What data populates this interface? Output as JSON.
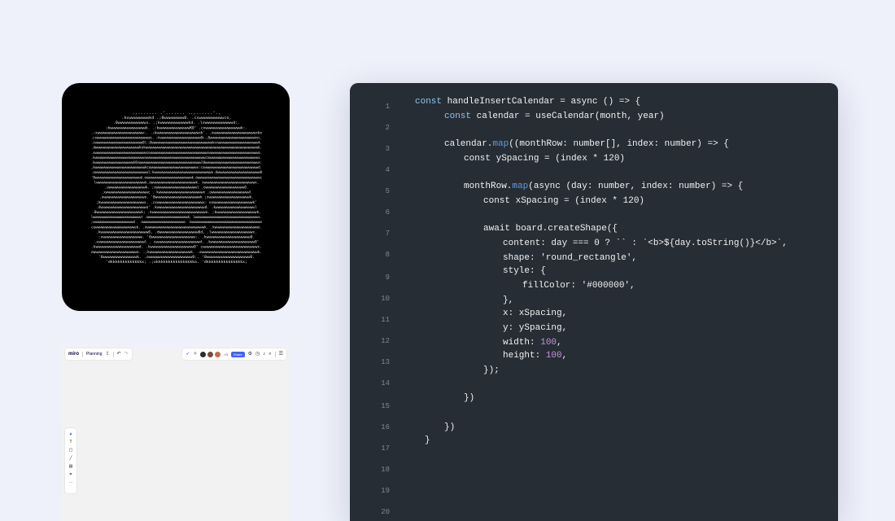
{
  "colors": {
    "page_bg": "#eef0fa",
    "editor_bg": "#262d34",
    "keyword": "#8dc6ef",
    "method": "#5e9fe0",
    "number": "#c792d8",
    "text": "#f1f2f4",
    "line_number": "#7e8794",
    "miro_accent": "#4262ff"
  },
  "ascii_card": {
    "lines": [
      " .,.......      .'.......     ..,......'.,",
      ".kxwwwwwwwwkd     .;0wwwwwwww0.     .cxwwwwwwwwwwco,",
      ".0wwwwwwwwwwwwx.    .;kwwwwwwwwwwwwkd.    .lxwwwwwwwwwwwwd:.",
      ";kwwwwwwwwwwwwwwwwk.   .:kwwwwwwwwwwwwwwK0'  .cxwwwwwwwwwwwwwwwwk:.",
      ".:xwwwwwwwwwwwwwwwwwwwwww:. .;kwwwwwwwwwwwwwwwwwwwwxk'. .xwwwwwwwwwwwwwwwwwwwwxko",
      ".cxwwwwwwwwwwwwwwwwwwwwwwwwwwwwoc.  ;kwwwwwwwwwwwwwwwwwwwwww0c.;0wwwwwwwwwwwwwwwwwwwwwwwwnoc.",
      ".cwwwwwwwwwwwwwwwwwwwwwwwwww0l:;0wwwwwwwwwwwwwwwwwwwwwwwwwwwwwwwwwkxxwwwwwwwwwwwwwwwwwwwwwwk.",
      ".dwwwwwwwwwwwwwwwwwwwwwwkokwwwwwwwwwwwwwwwwwwwwwwwwwwwwwwwwwwwwwwwwwwwwwwwwwwwwwwwwk.",
      ".xwwwwwwwwwwwwwwwwwwwwwwwwwwwwxxwwwwwwwwwwwwwwwwwwwwwwwwwwwwwwwxwwwwwwwwwwwwwwwwwwwwwwwwwwwo.",
      ".kwwwwwwwwwwwwwwwwwwwwwwwwwwwwxwwwwwwwwwwwwwwwwwwwwwwwwwwwwwwwwwwcowwwwwwwwwwwwwwwwwwwwwwwwwwwwc.",
      ".kwwwwwwwwwwwwwwwwwwwwwk0xwwwwwwwwwwwwwwwwwwwwwwwwwwwwwwwwwwl0wwwwwwwwwwwwwwwwwwwwwwwwwwwwwx:",
      ",kwwwwwwwwwwwwwwwwwwwwwwwwwwkcowwwwwwwwwwwwwwwwwwwwwwwwx:cxwwwwwwwwwwwwwwwwwwwwwwwwwwwwd.",
      ".owwwwwwwwwwwwwwwwwwwwwwwwwwl:kwwwwwwwwwwwwwwwwwwwwwwwwwwwwo.dwwwwwwwwwwwwwwwwwwwww0",
      "'0wwwwwwwwwwwwwwwwwwwwwwwwd.owwwwwwwwwwwwwwwwwwwwwwwwk.owwwwwwwwwwwwwwwwwwwwwwwwwwwwwwwwwc",
      "lwwwwwwwwwwwwwwwwwwwwwwwk.owwwwwwwwwwwwwwwwwwwwwk. xwwwwwwwwwwwwwwwwwwwwwwwwx.",
      ".owwwwwwwwwwwwwwwwwk. ;xwwwwwwwwwwwwwwwwwwwl  .owwwwwwwwwwwwwwwwww0.",
      ".xwwwwwwwwwwwwwwwwwwwwc . kwwwwwwwwwwwwwwwwwwwwwx .owwwwwwwwwwwwwwwwwwl",
      ".owwwwwwwwwwwwwwwwwwwo. '0wwwwwwwwwwwwwwwwwwwwwk  ;xwwwwwwwwwwwwwwwwwwwk.",
      ";kwwwwwwwwwwwwwwwwwwwwx. .cxwwwwwwwwwwwwwwwwwwwwwx:   oxwwwwwwwwwwwwwwwwwwk'",
      ".dwwwwwwwwwwwwwwwwwwwwwo'  .kwwwwwwwwwwwwwwwwwwwwwwd.  .kwwwwwwwwwwwwwwwwwwl",
      ".0wwwwwwwwwwwwwwwwwwwwk;   .kwwwwwwwwwwwwwwwwwwwwwwwwo.   ;kwwwwwwwwwwwwwwwwwwk.",
      "lwwwwwwwwwwwwwwwwwwwwwwwwwwwwr  .owwwwwwwwwwwwwwwwwwwwwwwk;  lwwwwwwwwwwwwwwwwwwwwwwwwwwwwwwwwwwwwws.",
      ";xwwwwwwwwwwwwwwwwwwwwwwwwwd .  .owwwwwwwwwwwwwwwwwwwwwwwwwwo.   .kwwwwwwwwwwwwwwwwwwwwwwwwwwwwwwwwwwwwwwwwwwwwo",
      "cowwwwwwwwwwwwwwwwwwwek.  .xwwwwwwwwwwwwwwwwwwwwwwwwwwwwk.  .kwwwwwwwwwwwwwwwwwwwwwo.",
      ".kwwwwwwwwwwwwwwwwwwwwww0,  .dwwwwwwwwwwwwwwwwww0d,  .lwwwwwwwwwwwwwwwwwwwx.",
      ":xwwwwwwwwwwwwwwwwww.   '0wwwwwwwwwwwwwwwwwwww:.  .kwwwwwwwwwwwwwwwwwwww0.",
      ".xwwwwwwwwwwwwwwwwwwwwwl  .  cwwwwwwwwwwwwwwwwwwwwd.  .kwwwwwwwwwwwwwwwwwwww0'",
      ".kwwwwwwwwwwwwwwwwwwwd.     .kwwwwwwwwwwwwwwwwwww0'    cwwwwwwwwwwwwwwwwwwwwwwwwx.",
      "owwwwwwwwwwwwwwwwwwwwo.    .;kwwwwwwwwwwwwwwwwwwwk.   .xwwwwwwwwwwwwwwwwwwwwwwwwwwk.",
      "'0wwwwwwwwwwwwwwk.       .owwwwwwwwwwwwwwwwww0:.    '0wwwwwwwwwwwwwwwwww0.",
      "'dkkkkkkkkkkkkkx;     .;okkkkkkkkkkkkkkkko.     'dkkkkkkkkkkkkkkkx;"
    ]
  },
  "miro": {
    "logo": "miro",
    "board_name": "Planning",
    "share_label": "Share",
    "collaborator_count": "+3"
  },
  "editor": {
    "line_numbers": [
      "1",
      "2",
      "3",
      "4",
      "5",
      "6",
      "7",
      "8",
      "9",
      "10",
      "11",
      "12",
      "13",
      "14",
      "15",
      "16",
      "17",
      "18",
      "19",
      "20"
    ],
    "code": {
      "l1_kw": "const",
      "l1_rest": " handleInsertCalendar = async () => {",
      "l2_kw": "const",
      "l2_rest": " calendar = useCalendar(month, year)",
      "l3_a": "calendar.",
      "l3_fn": "map",
      "l3_b": "((monthRow: number[], index: number) => {",
      "l4": "const ySpacing = (index * 120)",
      "l5_a": "monthRow.",
      "l5_fn": "map",
      "l5_b": "(async (day: number, index: number) => {",
      "l6": "const xSpacing = (index * 120)",
      "l7": "await board.createShape({",
      "l8": "content: day === 0 ? `` : `<b>${day.toString()}</b>`,",
      "l9": "shape: 'round_rectangle',",
      "l10": "style: {",
      "l11": "fillColor: '#000000',",
      "l12": "},",
      "l13": "x: xSpacing,",
      "l14": "y: ySpacing,",
      "l15_a": "width: ",
      "l15_num": "100",
      "l15_b": ",",
      "l16_a": "height: ",
      "l16_num": "100",
      "l16_b": ",",
      "l17": "});",
      "l18": "})",
      "l19": "})",
      "l20": "}"
    }
  }
}
